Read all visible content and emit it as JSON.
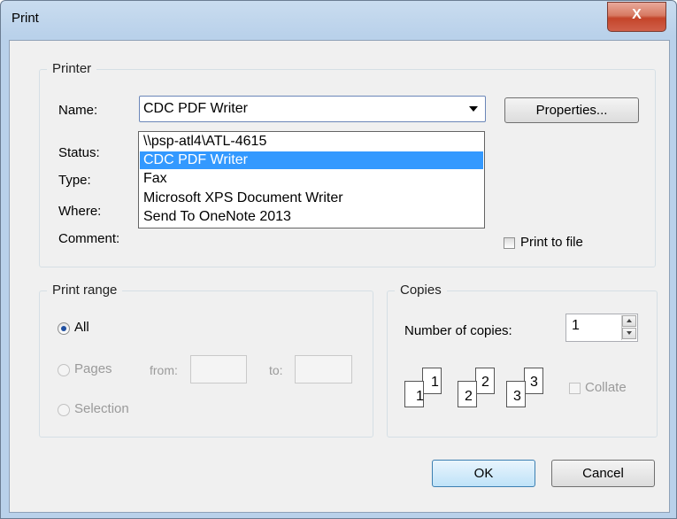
{
  "window": {
    "title": "Print",
    "close_glyph": "X"
  },
  "printer": {
    "legend": "Printer",
    "name_label": "Name:",
    "selected": "CDC PDF Writer",
    "properties_label": "Properties...",
    "status_label": "Status:",
    "type_label": "Type:",
    "where_label": "Where:",
    "comment_label": "Comment:",
    "print_to_file_label": "Print to file",
    "print_to_file_checked": false,
    "options": [
      "\\\\psp-atl4\\ATL-4615",
      "CDC PDF Writer",
      "Fax",
      "Microsoft XPS Document Writer",
      "Send To OneNote 2013"
    ]
  },
  "print_range": {
    "legend": "Print range",
    "all_label": "All",
    "pages_label": "Pages",
    "from_label": "from:",
    "to_label": "to:",
    "selection_label": "Selection",
    "selected": "All"
  },
  "copies": {
    "legend": "Copies",
    "number_label": "Number of copies:",
    "value": "1",
    "collate_label": "Collate",
    "collate_checked": false,
    "page_numbers": [
      "1",
      "1",
      "2",
      "2",
      "3",
      "3"
    ]
  },
  "buttons": {
    "ok": "OK",
    "cancel": "Cancel"
  },
  "colors": {
    "selection": "#3399ff",
    "close_button": "#c4442a"
  }
}
